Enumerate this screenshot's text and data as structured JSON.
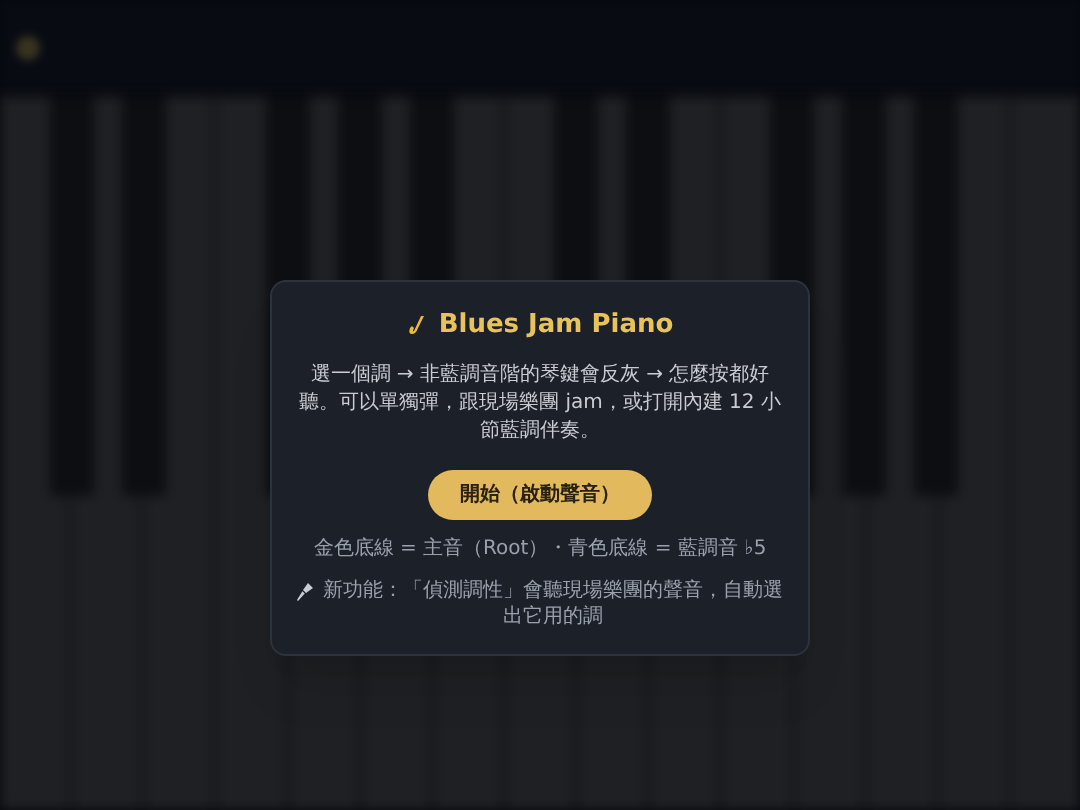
{
  "dialog": {
    "title": "Blues Jam Piano",
    "description": "選一個調 → 非藍調音階的琴鍵會反灰 → 怎麼按都好聽。可以單獨彈，跟現場樂團 jam，或打開內建 12 小節藍調伴奏。",
    "start_button": "開始（啟動聲音）",
    "legend": "金色底線 = 主音（Root）・青色底線 = 藍調音 ♭5",
    "note": "新功能：「偵測調性」會聽現場樂團的聲音，自動選出它用的調"
  }
}
